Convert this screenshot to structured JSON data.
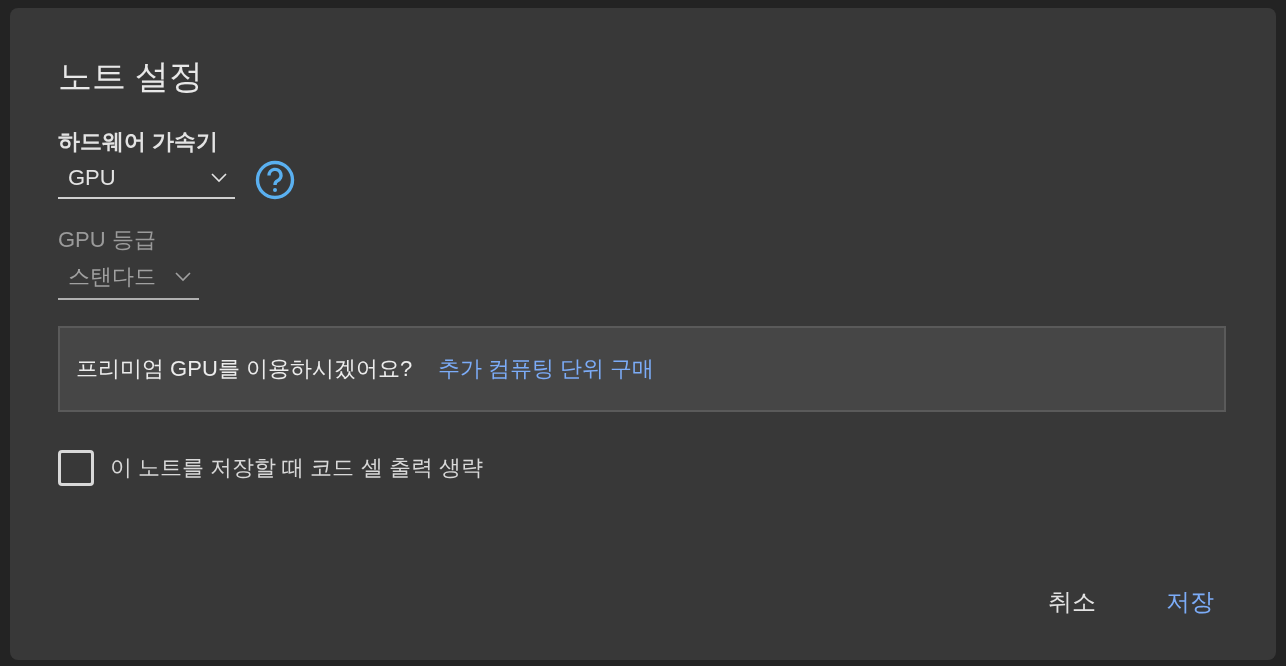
{
  "dialog": {
    "title": "노트 설정"
  },
  "accelerator": {
    "label": "하드웨어 가속기",
    "value": "GPU",
    "disabled": false
  },
  "gpu_tier": {
    "label": "GPU 등급",
    "value": "스탠다드",
    "disabled": true
  },
  "promo": {
    "text": "프리미엄 GPU를 이용하시겠어요?",
    "link": "추가 컴퓨팅 단위 구매"
  },
  "omit_output": {
    "label": "이 노트를 저장할 때 코드 셀 출력 생략",
    "checked": false
  },
  "buttons": [
    {
      "label": "취소",
      "kind": "cancel"
    },
    {
      "label": "저장",
      "kind": "primary"
    }
  ]
}
